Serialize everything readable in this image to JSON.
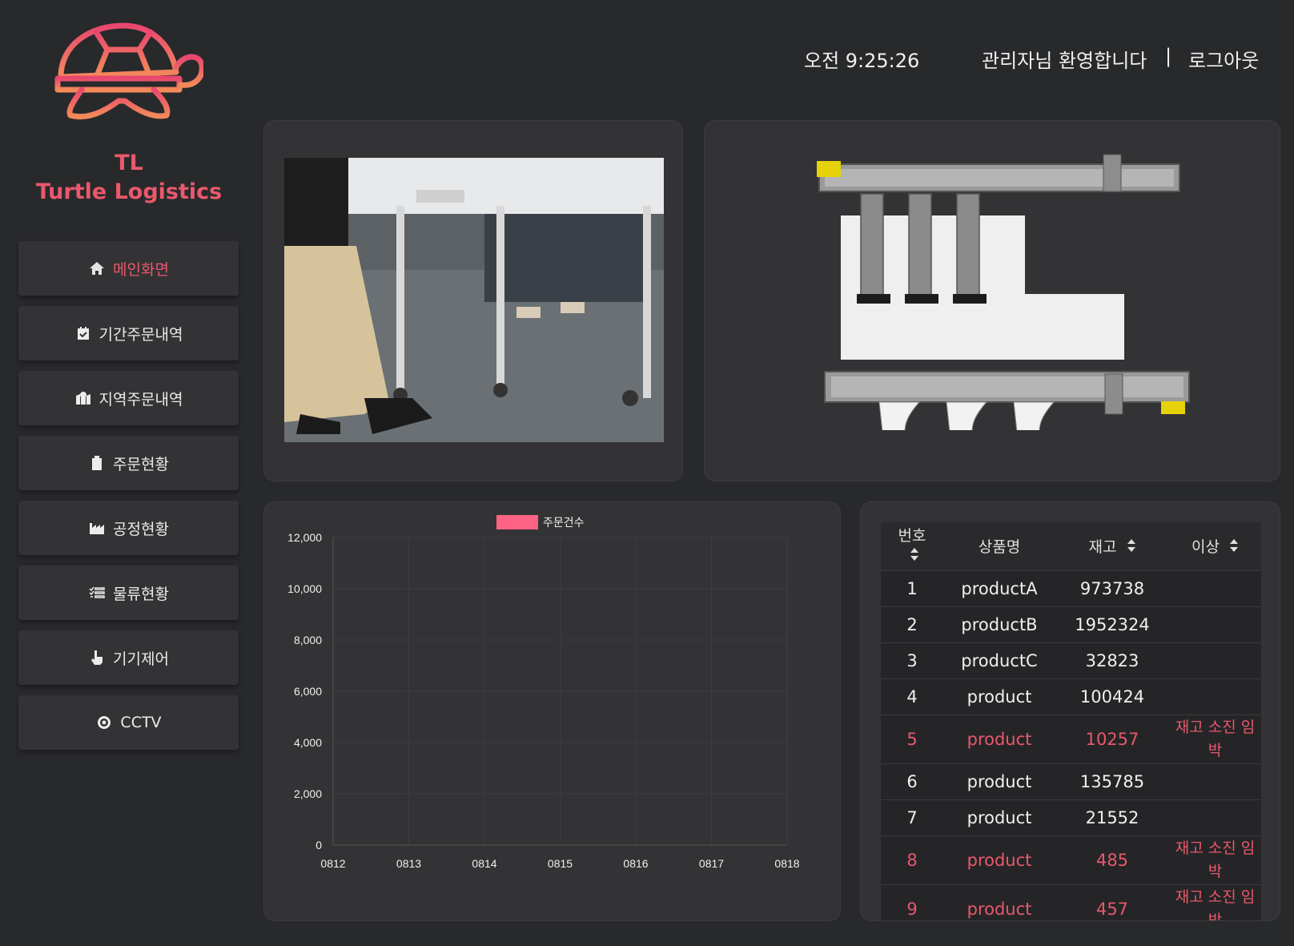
{
  "brand": {
    "short": "TL",
    "name": "Turtle Logistics"
  },
  "header": {
    "clock": "오전 9:25:26",
    "welcome": "관리자님 환영합니다",
    "separator": "|",
    "logout": "로그아웃"
  },
  "nav": [
    {
      "label": "메인화면",
      "icon": "home-icon"
    },
    {
      "label": "기간주문내역",
      "icon": "calendar-check-icon"
    },
    {
      "label": "지역주문내역",
      "icon": "map-location-icon"
    },
    {
      "label": "주문현황",
      "icon": "clipboard-icon"
    },
    {
      "label": "공정현황",
      "icon": "industry-icon"
    },
    {
      "label": "물류현황",
      "icon": "list-check-icon"
    },
    {
      "label": "기기제어",
      "icon": "hand-pointer-icon"
    },
    {
      "label": "CCTV",
      "icon": "record-icon"
    }
  ],
  "colors": {
    "accent": "#e9586c",
    "bg": "#28292b",
    "panel": "#333335"
  },
  "chart_data": {
    "type": "bar",
    "categories": [
      "0812",
      "0813",
      "0814",
      "0815",
      "0816",
      "0817",
      "0818"
    ],
    "series": [
      {
        "name": "주문건수",
        "values": [
          0,
          0,
          0,
          0,
          0,
          0,
          0
        ],
        "color": "#ff6384"
      }
    ],
    "yticks": [
      "0",
      "2,000",
      "4,000",
      "6,000",
      "8,000",
      "10,000",
      "12,000"
    ],
    "ylim": [
      0,
      12000
    ],
    "legend": "top",
    "grid": true
  },
  "table": {
    "headers": [
      "번호",
      "상품명",
      "재고",
      "이상"
    ],
    "rows": [
      {
        "no": "1",
        "name": "productA",
        "stock": "973738",
        "alert": ""
      },
      {
        "no": "2",
        "name": "productB",
        "stock": "1952324",
        "alert": ""
      },
      {
        "no": "3",
        "name": "productC",
        "stock": "32823",
        "alert": ""
      },
      {
        "no": "4",
        "name": "product",
        "stock": "100424",
        "alert": ""
      },
      {
        "no": "5",
        "name": "product",
        "stock": "10257",
        "alert": "재고 소진 임박"
      },
      {
        "no": "6",
        "name": "product",
        "stock": "135785",
        "alert": ""
      },
      {
        "no": "7",
        "name": "product",
        "stock": "21552",
        "alert": ""
      },
      {
        "no": "8",
        "name": "product",
        "stock": "485",
        "alert": "재고 소진 임박"
      },
      {
        "no": "9",
        "name": "product",
        "stock": "457",
        "alert": "재고 소진 임박"
      }
    ]
  }
}
